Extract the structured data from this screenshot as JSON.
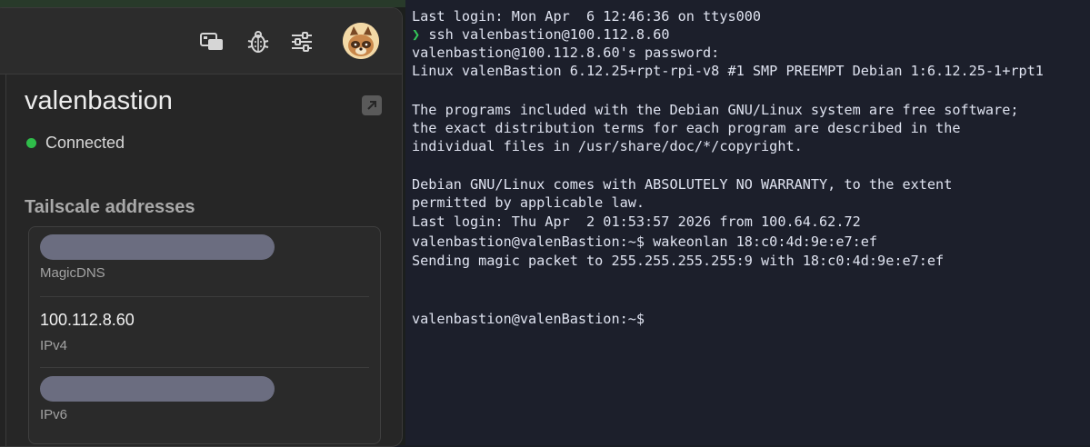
{
  "tailscale": {
    "toolbar": {
      "icons": [
        "screen-share-icon",
        "bug-icon",
        "sliders-icon"
      ],
      "avatar": "tanuki-avatar"
    },
    "device": {
      "name": "valenbastion",
      "status": "Connected",
      "status_color": "#2fbd4a"
    },
    "addresses": {
      "title": "Tailscale addresses",
      "items": [
        {
          "value": "",
          "label": "MagicDNS",
          "redacted": true
        },
        {
          "value": "100.112.8.60",
          "label": "IPv4",
          "redacted": false
        },
        {
          "value": "",
          "label": "IPv6",
          "redacted": true
        }
      ]
    }
  },
  "terminal": {
    "lines": [
      "Last login: Mon Apr  6 12:46:36 on ttys000",
      "ssh valenbastion@100.112.8.60",
      "valenbastion@100.112.8.60's password:",
      "Linux valenBastion 6.12.25+rpt-rpi-v8 #1 SMP PREEMPT Debian 1:6.12.25-1+rpt1",
      "",
      "The programs included with the Debian GNU/Linux system are free software;",
      "the exact distribution terms for each program are described in the",
      "individual files in /usr/share/doc/*/copyright.",
      "",
      "Debian GNU/Linux comes with ABSOLUTELY NO WARRANTY, to the extent",
      "permitted by applicable law.",
      "Last login: Thu Apr  2 01:53:57 2026 from 100.64.62.72",
      "valenbastion@valenBastion:~$ wakeonlan 18:c0:4d:9e:e7:ef",
      "Sending magic packet to 255.255.255.255:9 with 18:c0:4d:9e:e7:ef",
      "",
      "",
      "valenbastion@valenBastion:~$"
    ],
    "prompt_symbol": "❯",
    "prompt_color": "#34c759"
  }
}
